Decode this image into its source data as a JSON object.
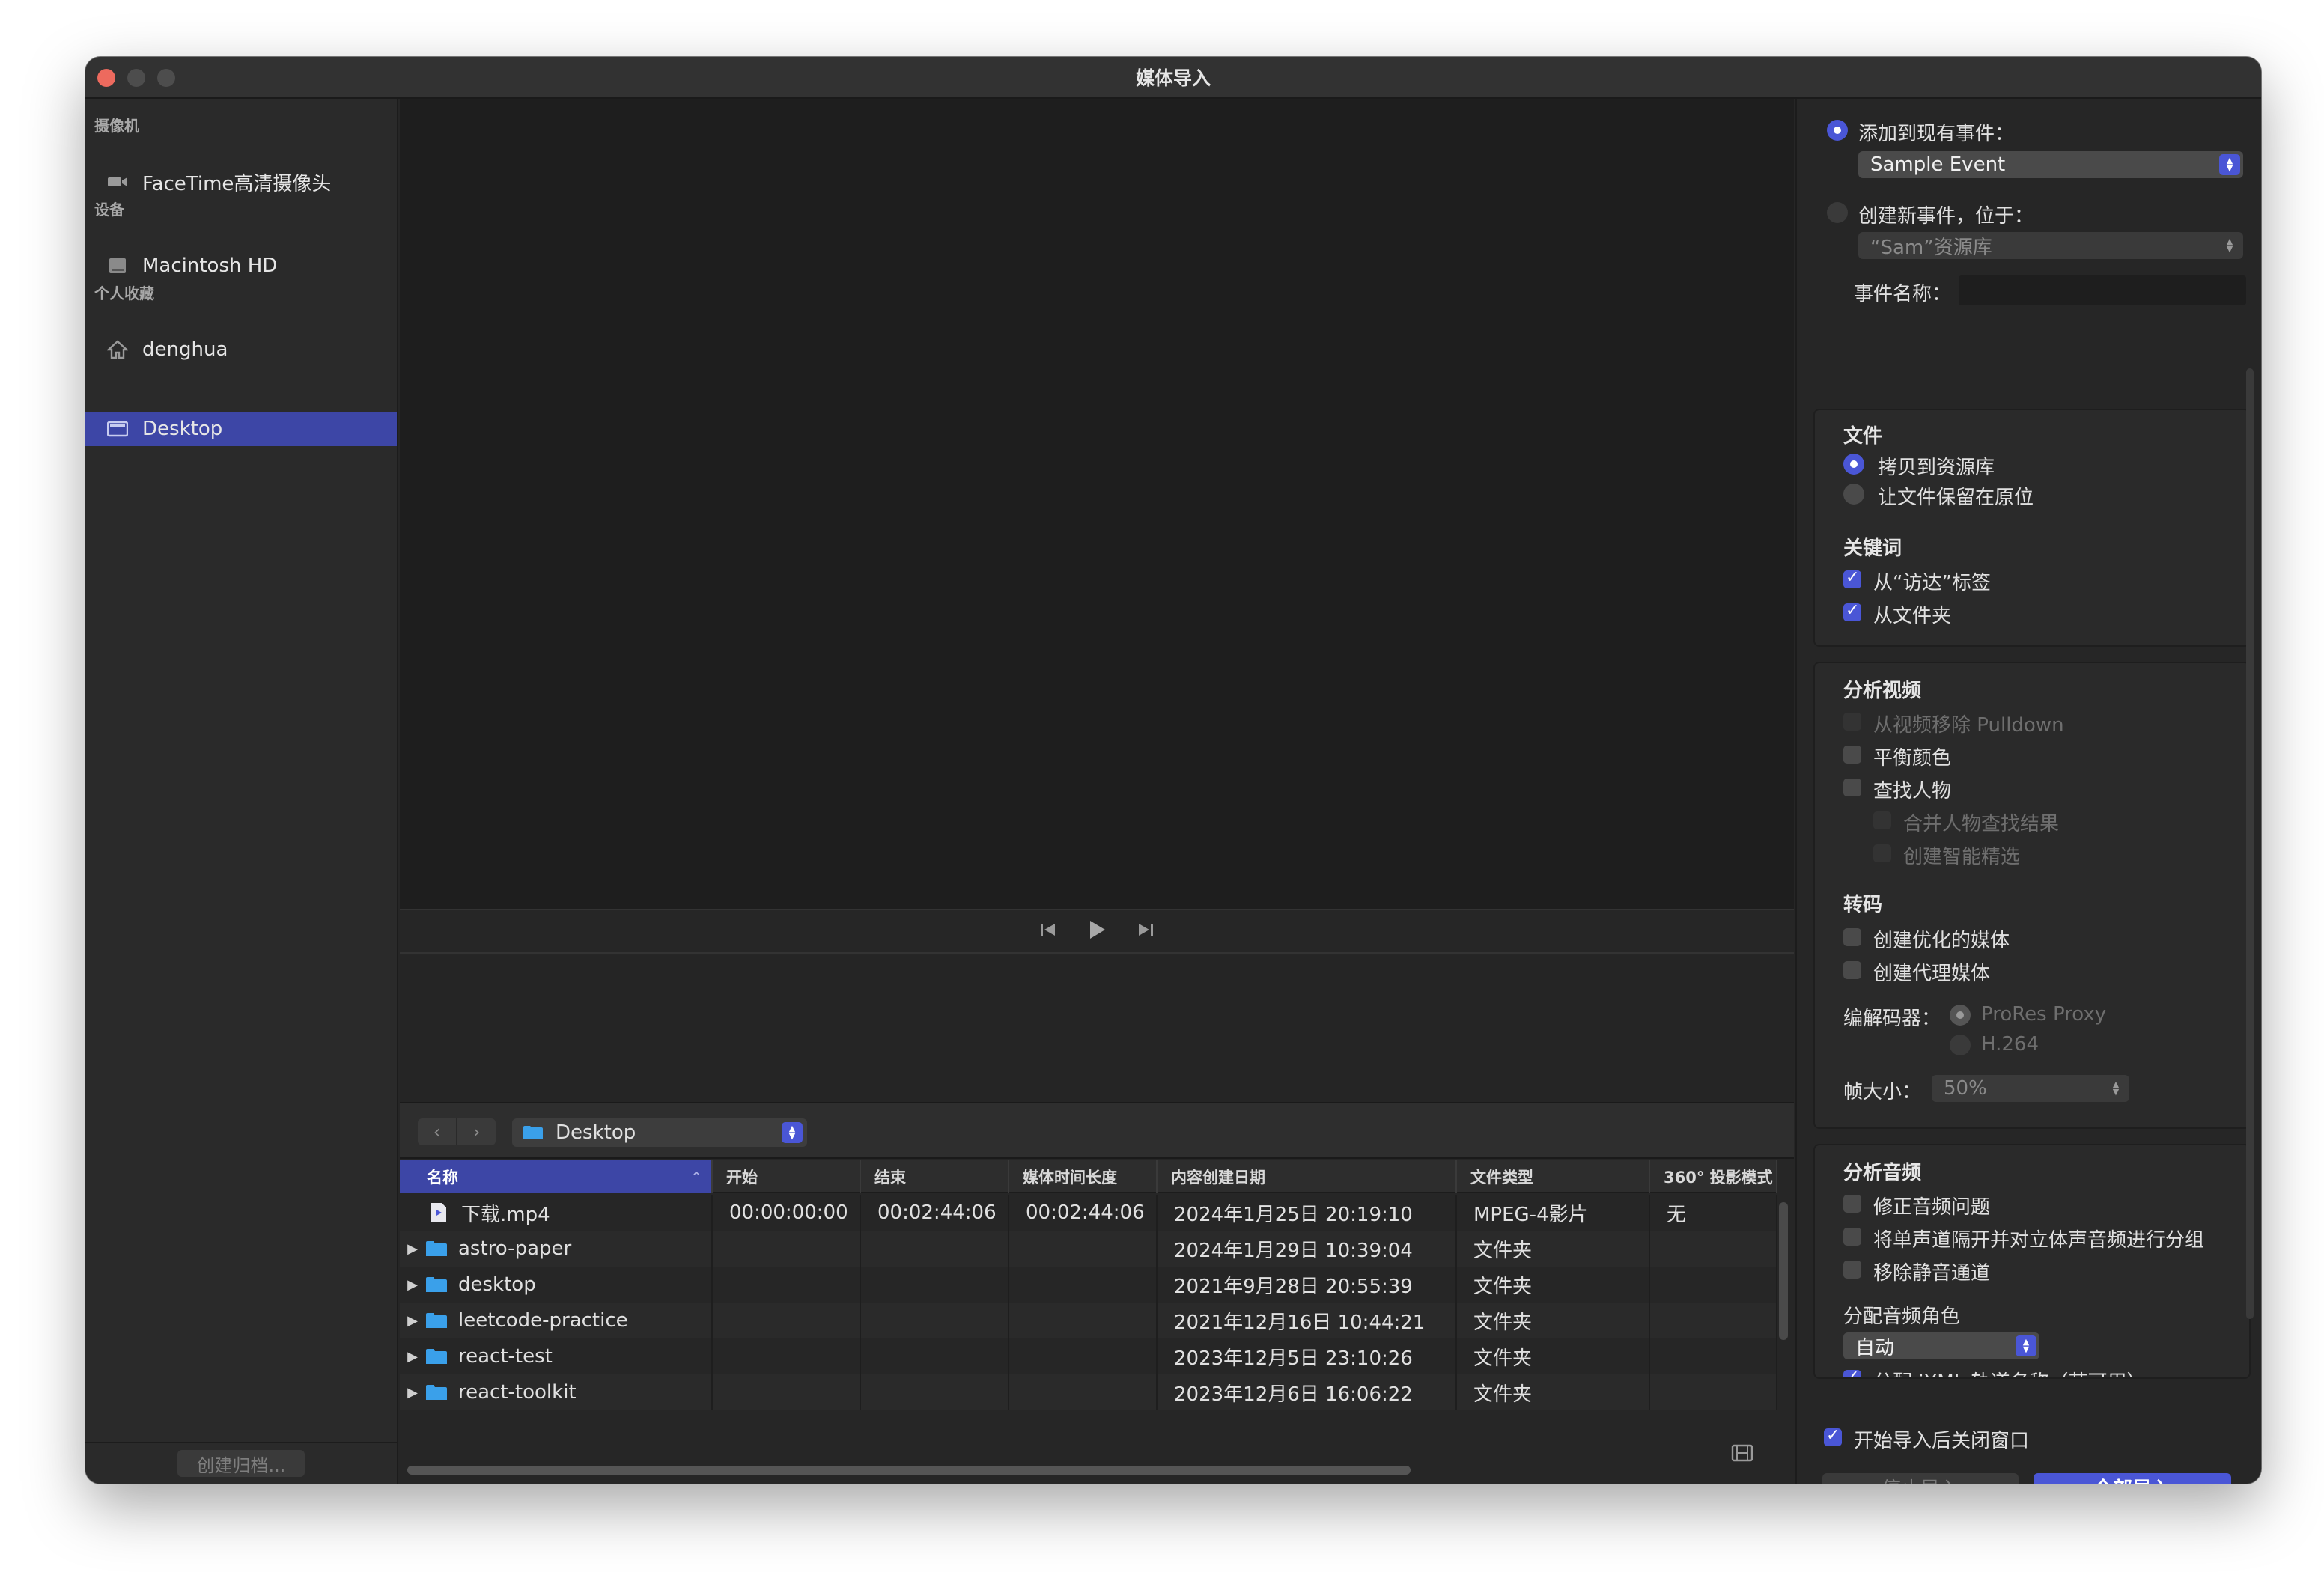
{
  "window": {
    "title": "媒体导入"
  },
  "sidebar": {
    "sections": [
      {
        "label": "摄像机",
        "items": [
          {
            "label": "FaceTime高清摄像头",
            "icon": "camera-icon"
          }
        ]
      },
      {
        "label": "设备",
        "items": [
          {
            "label": "Macintosh HD",
            "icon": "disk-icon"
          }
        ]
      },
      {
        "label": "个人收藏",
        "items": [
          {
            "label": "denghua",
            "icon": "home-icon"
          },
          {
            "label": "Desktop",
            "icon": "desktop-icon",
            "selected": true
          }
        ]
      }
    ],
    "archive_button": "创建归档..."
  },
  "browser": {
    "folder": "Desktop",
    "columns": [
      "名称",
      "开始",
      "结束",
      "媒体时间长度",
      "内容创建日期",
      "文件类型",
      "360° 投影模式"
    ],
    "rows": [
      {
        "name": "下载.mp4",
        "kind": "file",
        "start": "00:00:00:00",
        "end": "00:02:44:06",
        "duration": "00:02:44:06",
        "created": "2024年1月25日 20:19:10",
        "type": "MPEG-4影片",
        "projection": "无"
      },
      {
        "name": "astro-paper",
        "kind": "folder",
        "start": "",
        "end": "",
        "duration": "",
        "created": "2024年1月29日 10:39:04",
        "type": "文件夹",
        "projection": ""
      },
      {
        "name": "desktop",
        "kind": "folder",
        "start": "",
        "end": "",
        "duration": "",
        "created": "2021年9月28日 20:55:39",
        "type": "文件夹",
        "projection": ""
      },
      {
        "name": "leetcode-practice",
        "kind": "folder",
        "start": "",
        "end": "",
        "duration": "",
        "created": "2021年12月16日 10:44:21",
        "type": "文件夹",
        "projection": ""
      },
      {
        "name": "react-test",
        "kind": "folder",
        "start": "",
        "end": "",
        "duration": "",
        "created": "2023年12月5日 23:10:26",
        "type": "文件夹",
        "projection": ""
      },
      {
        "name": "react-toolkit",
        "kind": "folder",
        "start": "",
        "end": "",
        "duration": "",
        "created": "2023年12月6日 16:06:22",
        "type": "文件夹",
        "projection": ""
      }
    ]
  },
  "import": {
    "add_existing_label": "添加到现有事件：",
    "existing_event": "Sample Event",
    "create_new_label": "创建新事件，位于：",
    "library": "“Sam”资源库",
    "event_name_label": "事件名称：",
    "event_name_value": "",
    "files": {
      "title": "文件",
      "copy_label": "拷贝到资源库",
      "leave_label": "让文件保留在原位"
    },
    "keywords": {
      "title": "关键词",
      "finder_tags": "从“访达”标签",
      "folders": "从文件夹"
    },
    "analyze_video": {
      "title": "分析视频",
      "remove_pulldown": "从视频移除 Pulldown",
      "balance_color": "平衡颜色",
      "find_people": "查找人物",
      "consolidate_people": "合并人物查找结果",
      "smart_collections": "创建智能精选"
    },
    "transcode": {
      "title": "转码",
      "optimized": "创建优化的媒体",
      "proxy": "创建代理媒体",
      "codec_label": "编解码器：",
      "codec_prores": "ProRes Proxy",
      "codec_h264": "H.264",
      "frame_size_label": "帧大小：",
      "frame_size": "50%"
    },
    "analyze_audio": {
      "title": "分析音频",
      "fix_audio": "修正音频问题",
      "separate_mono": "将单声道隔开并对立体声音频进行分组",
      "remove_silent": "移除静音通道",
      "assign_roles_label": "分配音频角色",
      "role": "自动",
      "ixml": "分配 iXML 轨道名称（若可用）"
    },
    "close_after_label": "开始导入后关闭窗口",
    "stop_button": "停止导入",
    "import_all_button": "全部导入"
  }
}
